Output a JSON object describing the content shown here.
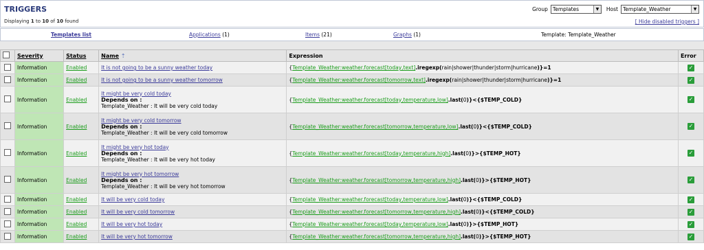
{
  "header": {
    "title": "TRIGGERS",
    "displaying_prefix": "Displaying",
    "displaying_from": "1",
    "displaying_to_word": "to",
    "displaying_to": "10",
    "displaying_of_word": "of",
    "displaying_total": "10",
    "displaying_suffix": "found",
    "group_label": "Group",
    "group_value": "Templates",
    "host_label": "Host",
    "host_value": "Template_Weather",
    "hide_link": "[ Hide disabled triggers ]"
  },
  "nav": {
    "templates_list": "Templates list",
    "applications": "Applications",
    "applications_count": "(1)",
    "items": "Items",
    "items_count": "(21)",
    "graphs": "Graphs",
    "graphs_count": "(1)",
    "template": "Template: Template_Weather"
  },
  "table": {
    "headers": {
      "severity": "Severity",
      "status": "Status",
      "name": "Name",
      "expression": "Expression",
      "error": "Error"
    },
    "depends_label": "Depends on :",
    "rows": [
      {
        "severity": "Information",
        "status": "Enabled",
        "name": "It is not going to be a sunny weather today",
        "expr_pre": "{",
        "expr_link": "Template_Weather:weather.forecast[today,text]",
        "expr_fn": ".iregexp(",
        "expr_post": "rain|shower|thunder|storm|hurricane",
        "expr_close": ")}=1",
        "depends": ""
      },
      {
        "severity": "Information",
        "status": "Enabled",
        "name": "It is not going to be a sunny weather tomorrow",
        "expr_pre": "{",
        "expr_link": "Template_Weather:weather.forecast[tomorrow,text]",
        "expr_fn": ".iregexp(",
        "expr_post": "rain|shower|thunder|storm|hurricane",
        "expr_close": ")}=1",
        "depends": ""
      },
      {
        "severity": "Information",
        "status": "Enabled",
        "name": "It might be very cold today",
        "expr_pre": "{",
        "expr_link": "Template_Weather:weather.forecast[today,temperature,low]",
        "expr_fn": ".last(",
        "expr_post": "0",
        "expr_close": ")}<{$TEMP_COLD}",
        "depends": "Template_Weather : It will be very cold today"
      },
      {
        "severity": "Information",
        "status": "Enabled",
        "name": "It might be very cold tomorrow",
        "expr_pre": "{",
        "expr_link": "Template_Weather:weather.forecast[tomorrow,temperature,low]",
        "expr_fn": ".last(",
        "expr_post": "0",
        "expr_close": ")}<{$TEMP_COLD}",
        "depends": "Template_Weather : It will be very cold tomorrow"
      },
      {
        "severity": "Information",
        "status": "Enabled",
        "name": "It might be very hot today",
        "expr_pre": "{",
        "expr_link": "Template_Weather:weather.forecast[today,temperature,high]",
        "expr_fn": ".last(",
        "expr_post": "0",
        "expr_close": ")}>{$TEMP_HOT}",
        "depends": "Template_Weather : It will be very hot today"
      },
      {
        "severity": "Information",
        "status": "Enabled",
        "name": "It might be very hot tomorrow",
        "expr_pre": "{",
        "expr_link": "Template_Weather:weather.forecast[tomorrow,temperature,high]",
        "expr_fn": ".last(",
        "expr_post": "0",
        "expr_close": ")}>{$TEMP_HOT}",
        "depends": "Template_Weather : It will be very hot tomorrow"
      },
      {
        "severity": "Information",
        "status": "Enabled",
        "name": "It will be very cold today",
        "expr_pre": "{",
        "expr_link": "Template_Weather:weather.forecast[today,temperature,low]",
        "expr_fn": ".last(",
        "expr_post": "0",
        "expr_close": ")}<{$TEMP_COLD}",
        "depends": ""
      },
      {
        "severity": "Information",
        "status": "Enabled",
        "name": "It will be very cold tomorrow",
        "expr_pre": "{",
        "expr_link": "Template_Weather:weather.forecast[tomorrow,temperature,high]",
        "expr_fn": ".last(",
        "expr_post": "0",
        "expr_close": ")}<{$TEMP_COLD}",
        "depends": ""
      },
      {
        "severity": "Information",
        "status": "Enabled",
        "name": "It will be very hot today",
        "expr_pre": "{",
        "expr_link": "Template_Weather:weather.forecast[today,temperature,low]",
        "expr_fn": ".last(",
        "expr_post": "0",
        "expr_close": ")}>{$TEMP_HOT}",
        "depends": ""
      },
      {
        "severity": "Information",
        "status": "Enabled",
        "name": "It will be very hot tomorrow",
        "expr_pre": "{",
        "expr_link": "Template_Weather:weather.forecast[tomorrow,temperature,high]",
        "expr_fn": ".last(",
        "expr_post": "0",
        "expr_close": ")}>{$TEMP_HOT}",
        "depends": ""
      }
    ]
  },
  "colors": {
    "severity_info": "#bfe6b5",
    "status_enabled": "#1a9c1a",
    "error_ok": "#2a9d3a"
  },
  "icons": {
    "sort": "sort-asc-icon",
    "error": "check-icon",
    "select_arrow": "chevron-down-icon"
  }
}
